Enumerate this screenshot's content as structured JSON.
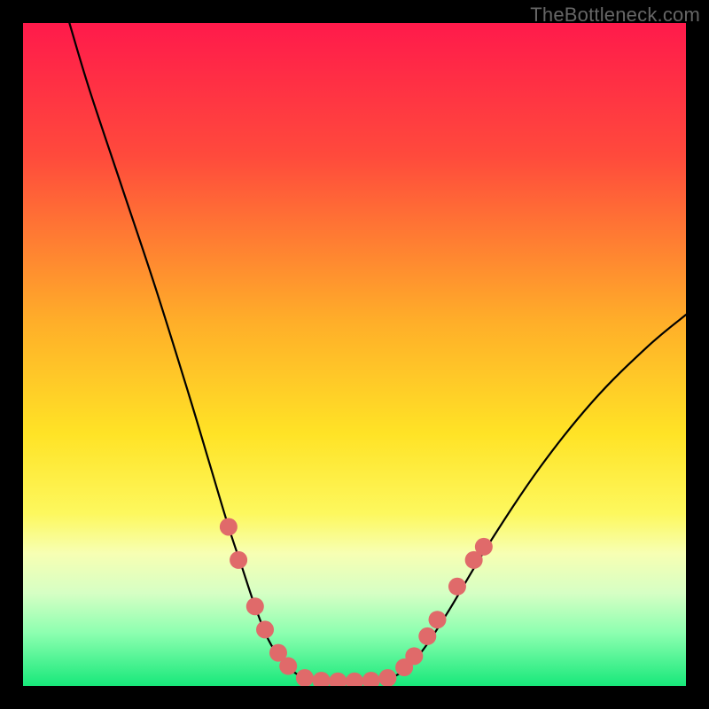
{
  "watermark": "TheBottleneck.com",
  "chart_data": {
    "type": "line",
    "title": "",
    "xlabel": "",
    "ylabel": "",
    "xlim": [
      0,
      100
    ],
    "ylim": [
      0,
      100
    ],
    "gradient_stops": [
      {
        "offset": 0,
        "color": "#ff1a4b"
      },
      {
        "offset": 20,
        "color": "#ff4a3c"
      },
      {
        "offset": 45,
        "color": "#ffae29"
      },
      {
        "offset": 62,
        "color": "#ffe326"
      },
      {
        "offset": 74,
        "color": "#fdf85e"
      },
      {
        "offset": 80,
        "color": "#f7ffb3"
      },
      {
        "offset": 86,
        "color": "#d6ffc4"
      },
      {
        "offset": 92,
        "color": "#8dffb0"
      },
      {
        "offset": 100,
        "color": "#17e87a"
      }
    ],
    "series": [
      {
        "name": "bottleneck-curve",
        "x": [
          7,
          10,
          15,
          20,
          25,
          28,
          31,
          33,
          35,
          37,
          39,
          41,
          43,
          46,
          50,
          54,
          57,
          60,
          64,
          70,
          78,
          86,
          94,
          100
        ],
        "y": [
          100,
          90,
          75,
          60,
          44,
          34,
          24,
          18,
          12,
          7,
          4,
          2,
          1,
          1,
          1,
          1,
          2,
          5,
          11,
          21,
          33,
          43,
          51,
          56
        ]
      }
    ],
    "markers": {
      "name": "highlight-dots",
      "color": "#e06a6a",
      "radius": 10,
      "points": [
        {
          "x": 31.0,
          "y": 24.0
        },
        {
          "x": 32.5,
          "y": 19.0
        },
        {
          "x": 35.0,
          "y": 12.0
        },
        {
          "x": 36.5,
          "y": 8.5
        },
        {
          "x": 38.5,
          "y": 5.0
        },
        {
          "x": 40.0,
          "y": 3.0
        },
        {
          "x": 42.5,
          "y": 1.2
        },
        {
          "x": 45.0,
          "y": 0.8
        },
        {
          "x": 47.5,
          "y": 0.7
        },
        {
          "x": 50.0,
          "y": 0.7
        },
        {
          "x": 52.5,
          "y": 0.8
        },
        {
          "x": 55.0,
          "y": 1.2
        },
        {
          "x": 57.5,
          "y": 2.8
        },
        {
          "x": 59.0,
          "y": 4.5
        },
        {
          "x": 61.0,
          "y": 7.5
        },
        {
          "x": 62.5,
          "y": 10.0
        },
        {
          "x": 65.5,
          "y": 15.0
        },
        {
          "x": 68.0,
          "y": 19.0
        },
        {
          "x": 69.5,
          "y": 21.0
        }
      ]
    }
  }
}
